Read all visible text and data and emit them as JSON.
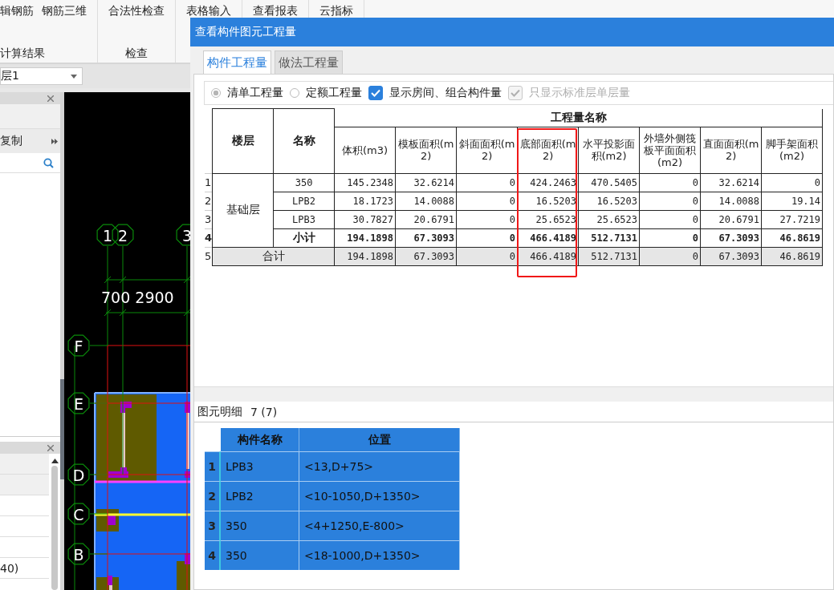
{
  "ribbon": {
    "groups": [
      {
        "label": "计算结果",
        "buttons": [
          "辑钢筋",
          "钢筋三维"
        ]
      },
      {
        "label": "检查",
        "buttons": [
          "合法性检查"
        ]
      },
      {
        "buttons": [
          "表格输入"
        ]
      },
      {
        "buttons": [
          "查看报表"
        ]
      },
      {
        "buttons": [
          "云指标"
        ]
      }
    ]
  },
  "floor_select": {
    "value": "层1"
  },
  "left_panel": {
    "toolbar_label": "复制",
    "lower_cell": "40)"
  },
  "drawing": {
    "top_axes": [
      "1",
      "2",
      "3"
    ],
    "dimension": "700 2900",
    "left_axes": [
      "F",
      "E",
      "D",
      "C",
      "B"
    ]
  },
  "dialog": {
    "title": "查看构件图元工程量",
    "tabs": [
      {
        "label": "构件工程量",
        "selected": true
      },
      {
        "label": "做法工程量",
        "selected": false
      }
    ],
    "options": [
      {
        "kind": "radio",
        "label": "清单工程量",
        "selected": true
      },
      {
        "kind": "radio",
        "label": "定额工程量",
        "selected": false
      },
      {
        "kind": "checkbox",
        "label": "显示房间、组合构件量",
        "checked": true,
        "disabled": false
      },
      {
        "kind": "checkbox",
        "label": "只显示标准层单层量",
        "checked": true,
        "disabled": true
      }
    ],
    "table": {
      "floor_header": "楼层",
      "name_header": "名称",
      "group_header": "工程量名称",
      "columns": [
        {
          "label": "体积(m3)",
          "highlighted": false
        },
        {
          "label": "模板面积(m2)",
          "highlighted": false
        },
        {
          "label": "斜面面积(m2)",
          "highlighted": false
        },
        {
          "label": "底部面积(m2)",
          "highlighted": true
        },
        {
          "label": "水平投影面积(m2)",
          "highlighted": false
        },
        {
          "label": "外墙外侧筏板平面面积(m2)",
          "highlighted": false
        },
        {
          "label": "直面面积(m2)",
          "highlighted": false
        },
        {
          "label": "脚手架面积(m2)",
          "highlighted": false
        }
      ],
      "groups": [
        {
          "floor": "基础层",
          "rows": [
            {
              "number": "1",
              "kind": "item",
              "name": "350",
              "values": [
                "145.2348",
                "32.6214",
                "0",
                "424.2463",
                "470.5405",
                "0",
                "32.6214",
                "0"
              ]
            },
            {
              "number": "2",
              "kind": "item",
              "name": "LPB2",
              "values": [
                "18.1723",
                "14.0088",
                "0",
                "16.5203",
                "16.5203",
                "0",
                "14.0088",
                "19.14"
              ]
            },
            {
              "number": "3",
              "kind": "item",
              "name": "LPB3",
              "values": [
                "30.7827",
                "20.6791",
                "0",
                "25.6523",
                "25.6523",
                "0",
                "20.6791",
                "27.7219"
              ]
            },
            {
              "number": "4",
              "kind": "subtotal",
              "name": "小计",
              "values": [
                "194.1898",
                "67.3093",
                "0",
                "466.4189",
                "512.7131",
                "0",
                "67.3093",
                "46.8619"
              ]
            }
          ]
        }
      ],
      "total": {
        "number": "5",
        "label": "合计",
        "values": [
          "194.1898",
          "67.3093",
          "0",
          "466.4189",
          "512.7131",
          "0",
          "67.3093",
          "46.8619"
        ]
      }
    },
    "detail": {
      "title": "图元明细",
      "count": "7 (7)",
      "columns": [
        "构件名称",
        "位置"
      ],
      "rows": [
        {
          "number": "1",
          "name": "LPB3",
          "position": "<13,D+75>"
        },
        {
          "number": "2",
          "name": "LPB2",
          "position": "<10-1050,D+1350>"
        },
        {
          "number": "3",
          "name": "350",
          "position": "<4+1250,E-800>"
        },
        {
          "number": "4",
          "name": "350",
          "position": "<18-1000,D+1350>"
        }
      ]
    }
  }
}
